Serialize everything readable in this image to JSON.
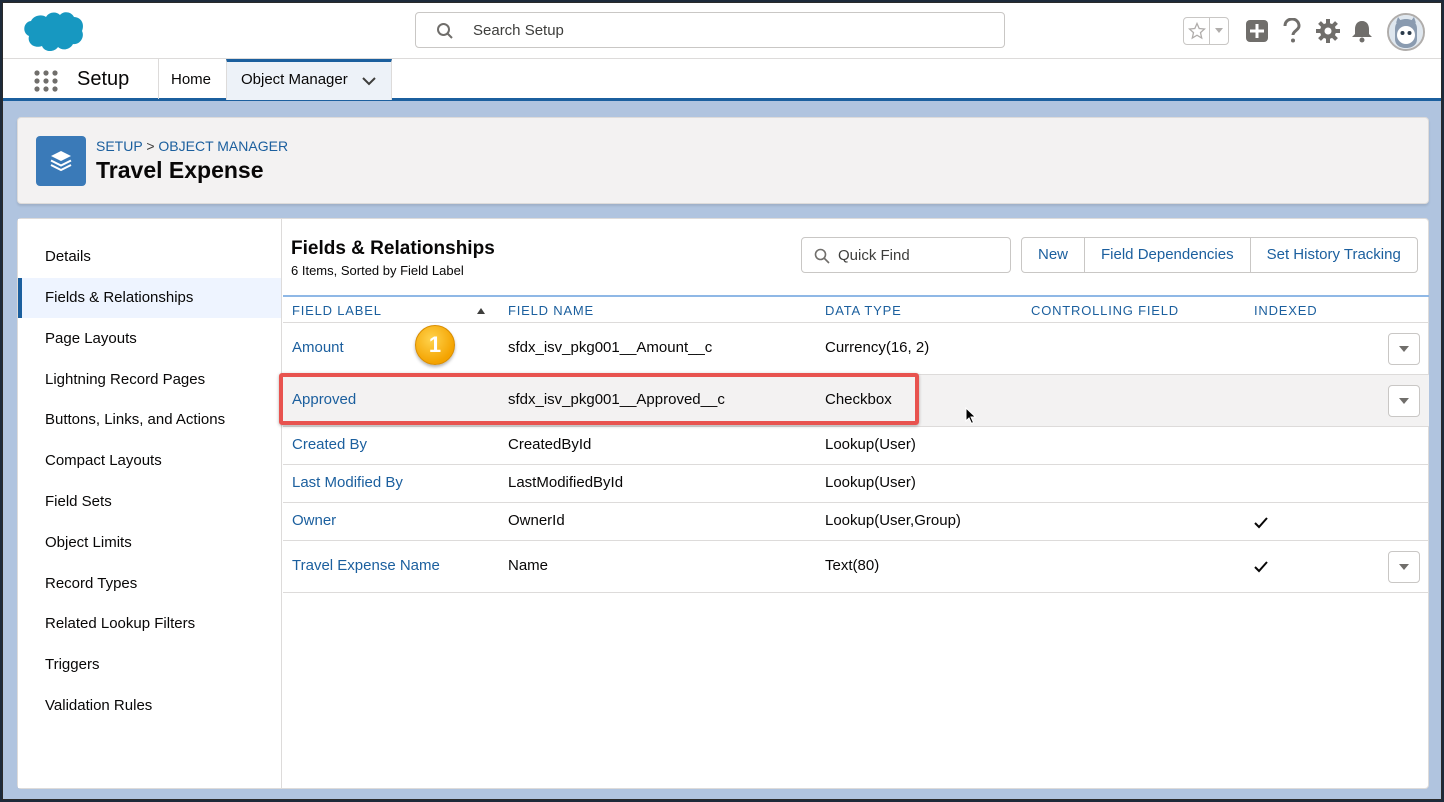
{
  "header": {
    "search_placeholder": "Search Setup",
    "icons": [
      "salesforce-logo",
      "search-icon",
      "star-icon",
      "chevron-down-icon",
      "plus-icon",
      "help-icon",
      "gear-icon",
      "bell-icon",
      "avatar"
    ]
  },
  "context_bar": {
    "app_name": "Setup",
    "tabs": [
      {
        "label": "Home"
      },
      {
        "label": "Object Manager",
        "active": true
      }
    ]
  },
  "page_header": {
    "breadcrumb": [
      "SETUP",
      "OBJECT MANAGER"
    ],
    "breadcrumb_sep": ">",
    "title": "Travel Expense"
  },
  "left_nav": {
    "items": [
      "Details",
      "Fields & Relationships",
      "Page Layouts",
      "Lightning Record Pages",
      "Buttons, Links, and Actions",
      "Compact Layouts",
      "Field Sets",
      "Object Limits",
      "Record Types",
      "Related Lookup Filters",
      "Triggers",
      "Validation Rules"
    ],
    "active_index": 1
  },
  "section": {
    "title": "Fields & Relationships",
    "subtitle": "6 Items, Sorted by Field Label",
    "quick_find_placeholder": "Quick Find",
    "buttons": [
      "New",
      "Field Dependencies",
      "Set History Tracking"
    ]
  },
  "table": {
    "columns": [
      "FIELD LABEL",
      "FIELD NAME",
      "DATA TYPE",
      "CONTROLLING FIELD",
      "INDEXED"
    ],
    "rows": [
      {
        "label": "Amount",
        "name": "sfdx_isv_pkg001__Amount__c",
        "type": "Currency(16, 2)",
        "controlling": "",
        "indexed": false,
        "menu": true
      },
      {
        "label": "Approved",
        "name": "sfdx_isv_pkg001__Approved__c",
        "type": "Checkbox",
        "controlling": "",
        "indexed": false,
        "menu": true
      },
      {
        "label": "Created By",
        "name": "CreatedById",
        "type": "Lookup(User)",
        "controlling": "",
        "indexed": false,
        "menu": false
      },
      {
        "label": "Last Modified By",
        "name": "LastModifiedById",
        "type": "Lookup(User)",
        "controlling": "",
        "indexed": false,
        "menu": false
      },
      {
        "label": "Owner",
        "name": "OwnerId",
        "type": "Lookup(User,Group)",
        "controlling": "",
        "indexed": true,
        "menu": false
      },
      {
        "label": "Travel Expense Name",
        "name": "Name",
        "type": "Text(80)",
        "controlling": "",
        "indexed": true,
        "menu": true
      }
    ]
  },
  "annotation": {
    "callout_number": "1",
    "highlighted_row": "Approved"
  },
  "colors": {
    "brand_blue": "#1b5f9e",
    "highlight_red": "#e8534f",
    "callout_orange": "#f4a300"
  }
}
